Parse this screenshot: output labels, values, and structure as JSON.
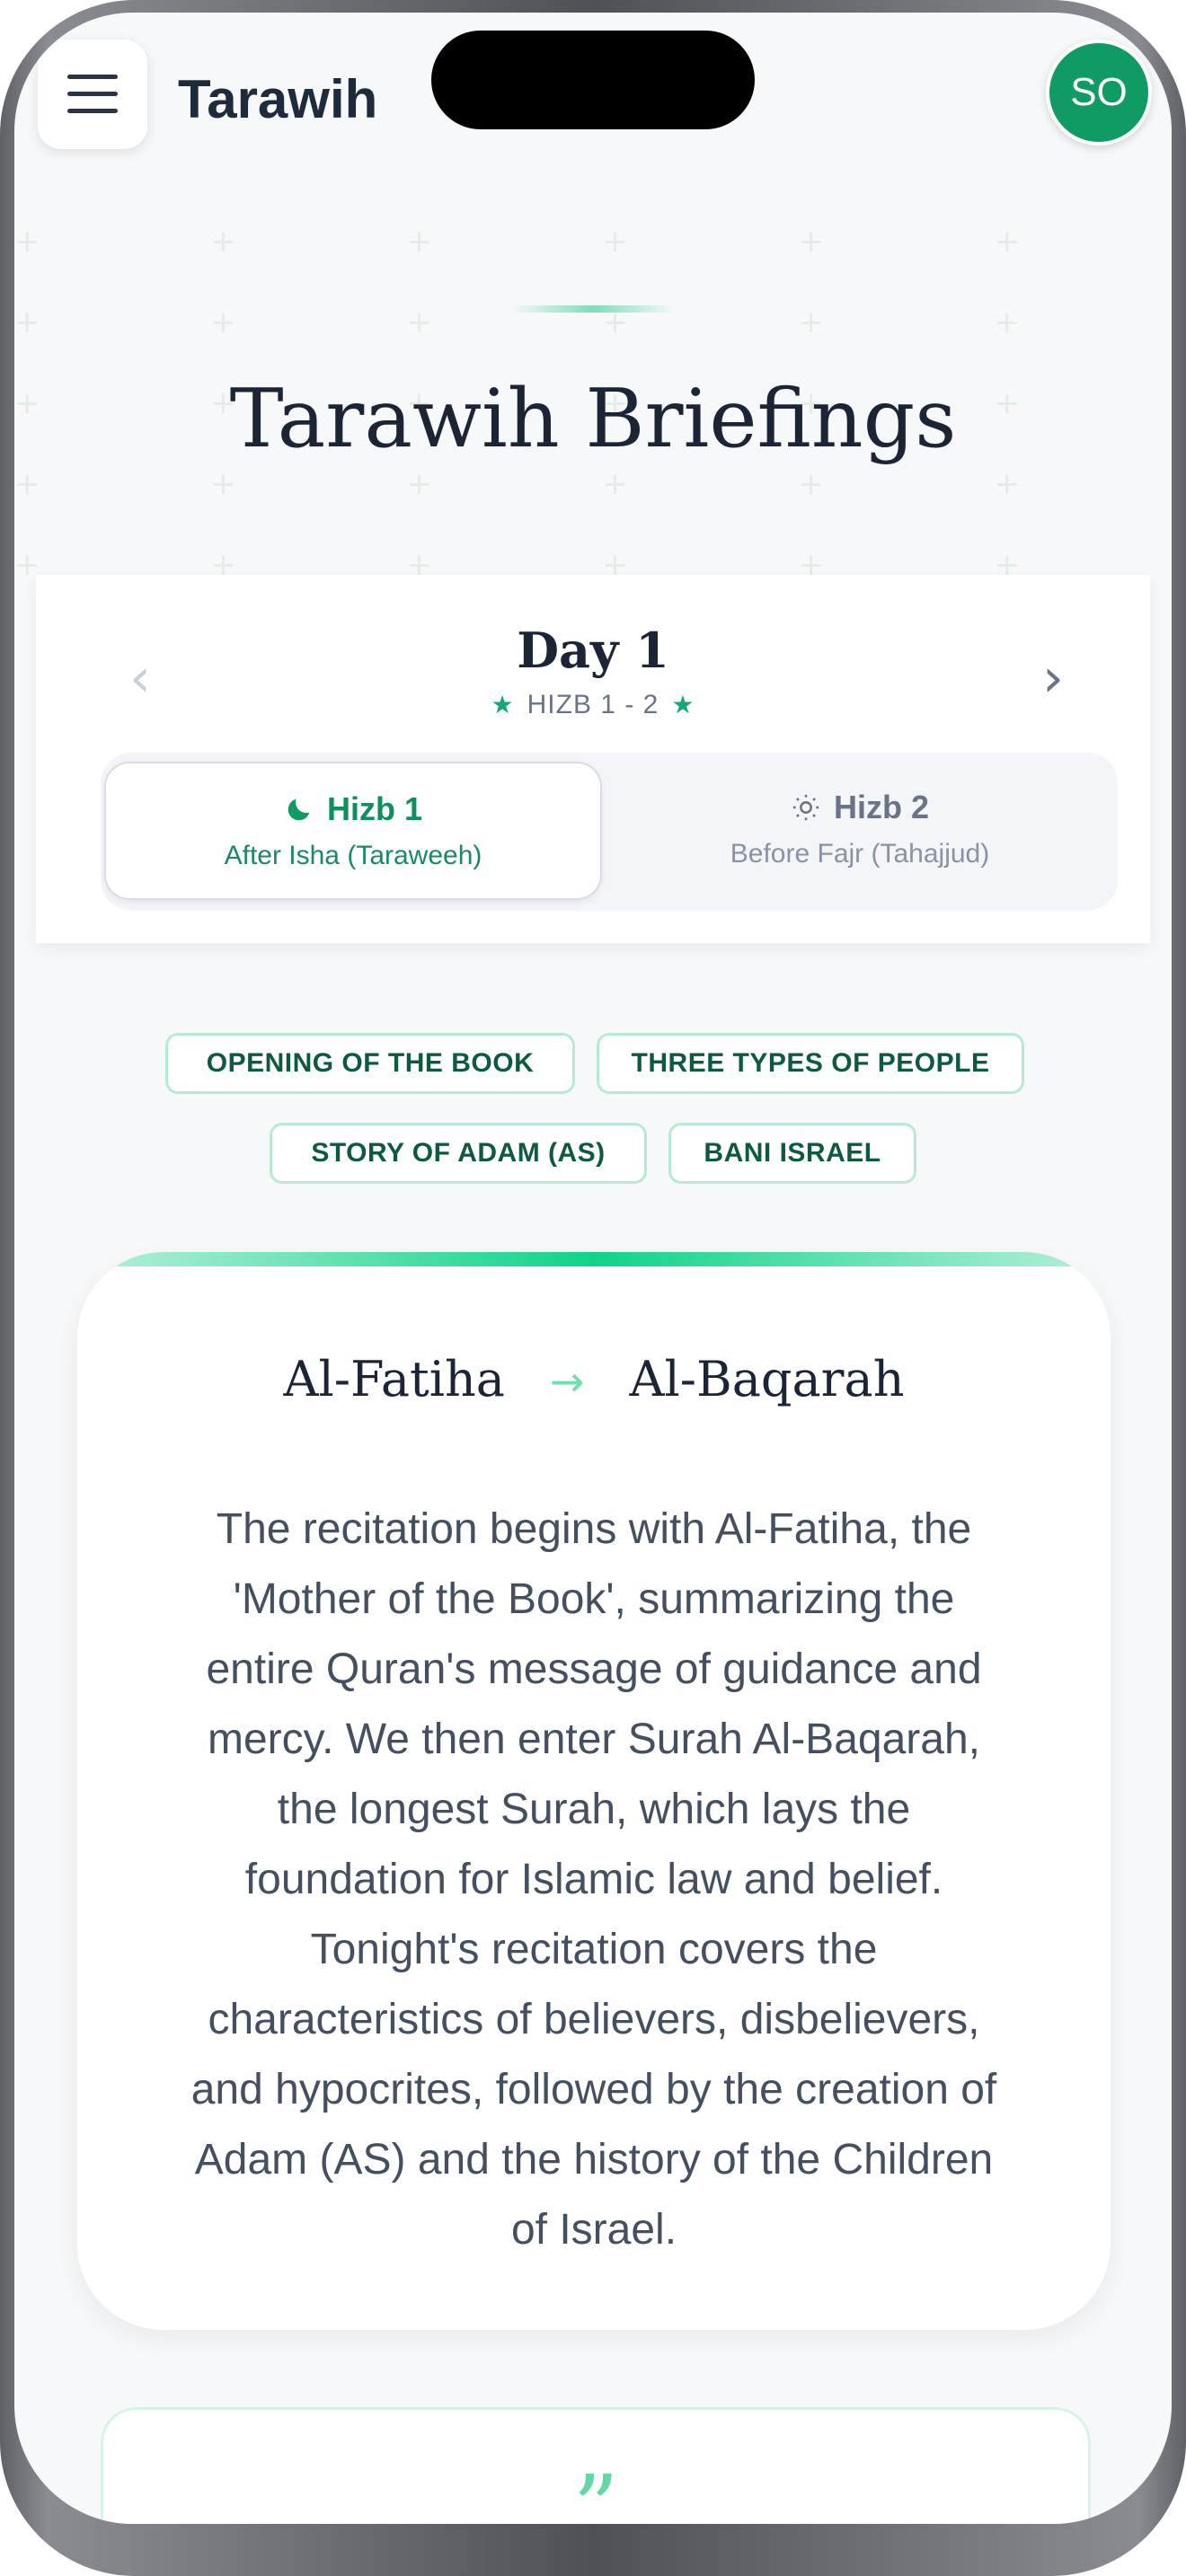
{
  "header": {
    "app_title": "Tarawih",
    "avatar_initials": "SO"
  },
  "page": {
    "title": "Tarawih Briefings"
  },
  "day_selector": {
    "day_label": "Day 1",
    "hizb_range": "HIZB 1 - 2",
    "prev_icon": "chevron-left-icon",
    "next_icon": "chevron-right-icon"
  },
  "hizb_tabs": [
    {
      "label": "Hizb 1",
      "time": "After Isha (Taraweeh)",
      "icon": "moon-icon",
      "active": true
    },
    {
      "label": "Hizb 2",
      "time": "Before Fajr (Tahajjud)",
      "icon": "sun-icon",
      "active": false
    }
  ],
  "topics": [
    "OPENING OF THE BOOK",
    "THREE TYPES OF PEOPLE",
    "STORY OF ADAM (AS)",
    "BANI ISRAEL"
  ],
  "briefing": {
    "from_surah": "Al-Fatiha",
    "to_surah": "Al-Baqarah",
    "summary": "The recitation begins with Al-Fatiha, the 'Mother of the Book', summarizing the entire Quran's message of guidance and mercy. We then enter Surah Al-Baqarah, the longest Surah, which lays the foundation for Islamic law and belief. Tonight's recitation covers the characteristics of believers, disbelievers, and hypocrites, followed by the creation of Adam (AS) and the history of the Children of Israel."
  },
  "quote": {
    "icon": "quote-icon"
  },
  "colors": {
    "accent_green": "#0f9b63",
    "tag_border": "#b7ead2",
    "text_dark": "#1b2536"
  }
}
